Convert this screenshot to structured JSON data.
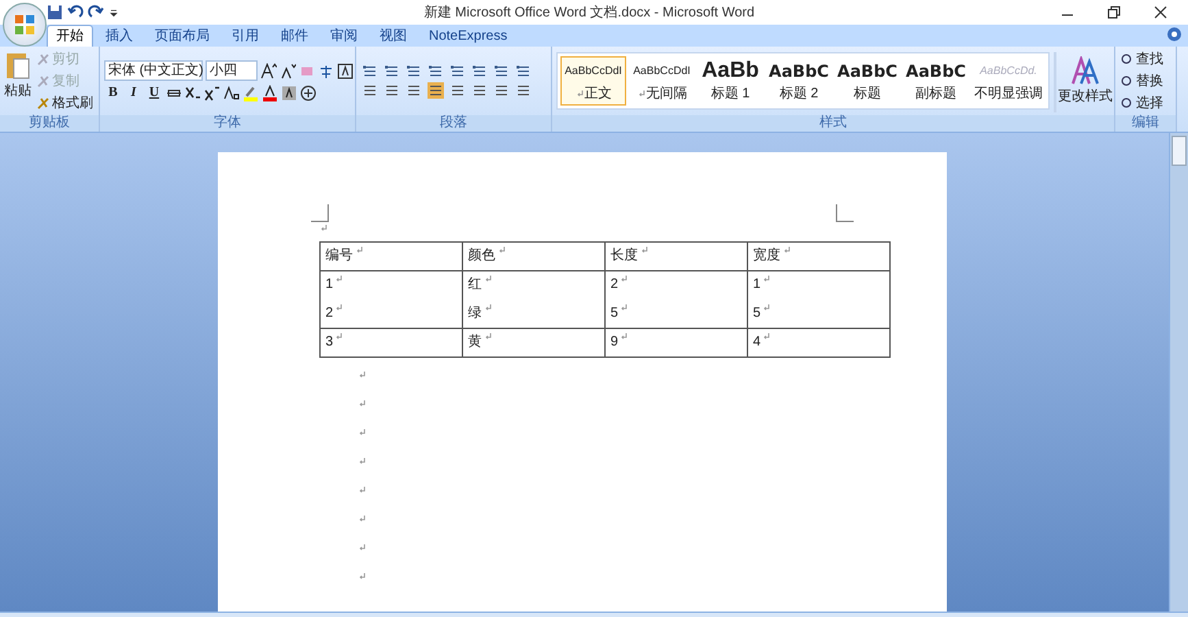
{
  "window": {
    "title": "新建 Microsoft Office Word 文档.docx - Microsoft Word"
  },
  "tabs": [
    {
      "label": "开始",
      "selected": true
    },
    {
      "label": "插入",
      "selected": false
    },
    {
      "label": "页面布局",
      "selected": false
    },
    {
      "label": "引用",
      "selected": false
    },
    {
      "label": "邮件",
      "selected": false
    },
    {
      "label": "审阅",
      "selected": false
    },
    {
      "label": "视图",
      "selected": false
    },
    {
      "label": "NoteExpress",
      "selected": false
    }
  ],
  "clipboard": {
    "label": "剪贴板",
    "paste": "粘贴",
    "items": [
      {
        "label": "剪切",
        "disabled": true
      },
      {
        "label": "复制",
        "disabled": true
      },
      {
        "label": "格式刷",
        "disabled": false
      }
    ]
  },
  "font": {
    "label": "字体",
    "name": "宋体 (中文正文)",
    "size": "小四",
    "format_buttons": [
      "B",
      "I",
      "U"
    ]
  },
  "paragraph": {
    "label": "段落"
  },
  "styles": {
    "label": "样式",
    "change": "更改样式",
    "items": [
      {
        "preview": "AaBbCcDdI",
        "name": "正文",
        "kind": "small",
        "selected": true
      },
      {
        "preview": "AaBbCcDdI",
        "name": "无间隔",
        "kind": "small",
        "selected": false
      },
      {
        "preview": "AaBb",
        "name": "标题 1",
        "kind": "large",
        "selected": false
      },
      {
        "preview": "AaBbC",
        "name": "标题 2",
        "kind": "medium",
        "selected": false
      },
      {
        "preview": "AaBbC",
        "name": "标题",
        "kind": "medium",
        "selected": false
      },
      {
        "preview": "AaBbC",
        "name": "副标题",
        "kind": "medium",
        "selected": false
      },
      {
        "preview": "AaBbCcDd.",
        "name": "不明显强调",
        "kind": "faint",
        "selected": false
      }
    ]
  },
  "editing": {
    "label": "编辑",
    "items": [
      "查找",
      "替换",
      "选择"
    ]
  },
  "table": {
    "columns": [
      "编号",
      "颜色",
      "长度",
      "宽度"
    ],
    "rows": [
      [
        [
          "1",
          "2"
        ],
        [
          "红",
          "绿"
        ],
        [
          "2",
          "5"
        ],
        [
          "1",
          "5"
        ]
      ],
      [
        [
          "3"
        ],
        [
          "黄"
        ],
        [
          "9"
        ],
        [
          "4"
        ]
      ]
    ]
  }
}
